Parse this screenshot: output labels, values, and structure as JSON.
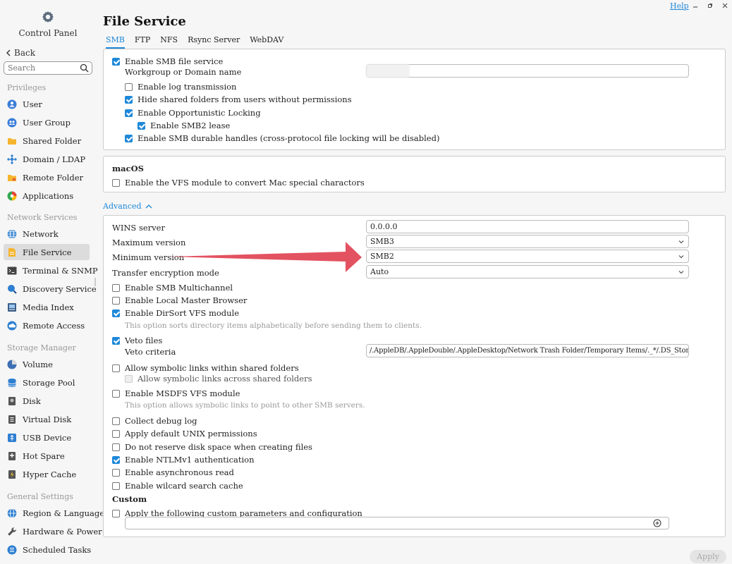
{
  "sidebar": {
    "title": "Control Panel",
    "back_label": "Back",
    "search_placeholder": "Search",
    "sections": {
      "privileges": "Privileges",
      "network_services": "Network Services",
      "storage_manager": "Storage Manager",
      "general_settings": "General Settings"
    },
    "items": {
      "user": "User",
      "user_group": "User Group",
      "shared_folder": "Shared Folder",
      "domain_ldap": "Domain / LDAP",
      "remote_folder": "Remote Folder",
      "applications": "Applications",
      "network": "Network",
      "file_service": "File Service",
      "terminal_snmp": "Terminal & SNMP",
      "discovery_service": "Discovery Service",
      "media_index": "Media Index",
      "remote_access": "Remote Access",
      "volume": "Volume",
      "storage_pool": "Storage Pool",
      "disk": "Disk",
      "virtual_disk": "Virtual Disk",
      "usb_device": "USB Device",
      "hot_spare": "Hot Spare",
      "hyper_cache": "Hyper Cache",
      "region_language": "Region & Language",
      "hardware_power": "Hardware & Power",
      "scheduled_tasks": "Scheduled Tasks"
    }
  },
  "header": {
    "help": "Help",
    "title": "File Service",
    "tabs": [
      "SMB",
      "FTP",
      "NFS",
      "Rsync Server",
      "WebDAV"
    ]
  },
  "smb": {
    "enable_smb": "Enable SMB file service",
    "workgroup_label": "Workgroup or Domain name",
    "enable_log": "Enable log transmission",
    "hide_shared": "Hide shared folders from users without permissions",
    "opportunistic_locking": "Enable Opportunistic Locking",
    "smb2_lease": "Enable SMB2 lease",
    "durable_handles": "Enable SMB durable handles (cross-protocol file locking will be disabled)"
  },
  "macos": {
    "heading": "macOS",
    "vfs_mac": "Enable the VFS module to convert Mac special charactors"
  },
  "advanced": {
    "toggle_label": "Advanced",
    "wins_label": "WINS server",
    "wins_value": "0.0.0.0",
    "max_version_label": "Maximum version",
    "max_version_value": "SMB3",
    "min_version_label": "Minimum version",
    "min_version_value": "SMB2",
    "transfer_enc_label": "Transfer encryption mode",
    "transfer_enc_value": "Auto",
    "multichannel": "Enable SMB Multichannel",
    "local_master": "Enable Local Master Browser",
    "dirsort": "Enable DirSort VFS module",
    "dirsort_note": "This option sorts directory items alphabetically before sending them to clients.",
    "veto_files": "Veto files",
    "veto_criteria_label": "Veto criteria",
    "veto_criteria_value": "/.AppleDB/.AppleDouble/.AppleDesktop/Network Trash Folder/Temporary Items/._*/.DS_Store/Thumbs.db/.safe/",
    "symlinks_within": "Allow symbolic links within shared folders",
    "symlinks_across": "Allow symbolic links across shared folders",
    "msdfs": "Enable MSDFS VFS module",
    "msdfs_note": "This option allows symbolic links to point to other SMB servers.",
    "debug_log": "Collect debug log",
    "unix_perms": "Apply default UNIX permissions",
    "no_reserve": "Do not reserve disk space when creating files",
    "ntlmv1": "Enable NTLMv1 authentication",
    "async_read": "Enable asynchronous read",
    "wildcard_cache": "Enable wilcard search cache",
    "custom_heading": "Custom",
    "custom_params": "Apply the following custom parameters and configuration"
  },
  "footer": {
    "apply": "Apply"
  },
  "colors": {
    "accent": "#1e88d8",
    "arrow": "#e35260"
  }
}
